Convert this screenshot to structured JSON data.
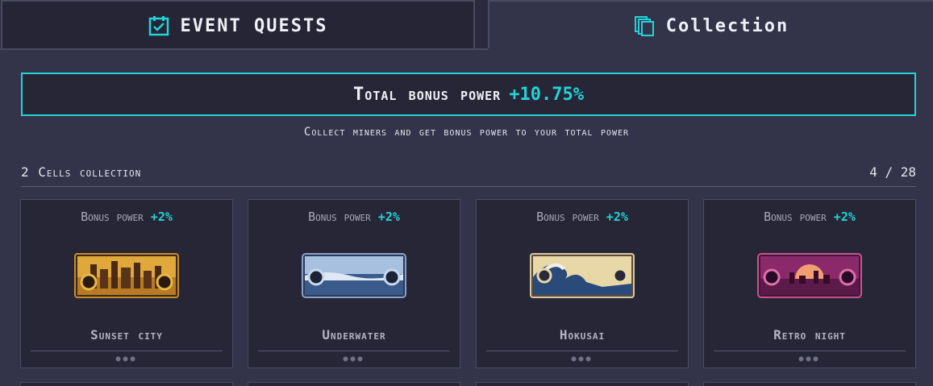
{
  "tabs": {
    "quests": {
      "label": "EVENT QUESTS",
      "icon": "calendar-check-icon"
    },
    "collection": {
      "label": "Collection",
      "icon": "cards-icon",
      "active": true
    }
  },
  "bonus": {
    "label": "Total bonus power",
    "value": "+10.75%"
  },
  "subtitle": "Collect miners and get bonus power to your total power",
  "section": {
    "title": "2 Cells collection",
    "count": "4 / 28"
  },
  "cards": [
    {
      "bonus_label": "Bonus power",
      "bonus_value": "+2%",
      "name": "Sunset city",
      "art": "sunset-city-miner-icon"
    },
    {
      "bonus_label": "Bonus power",
      "bonus_value": "+2%",
      "name": "Underwater",
      "art": "underwater-miner-icon"
    },
    {
      "bonus_label": "Bonus power",
      "bonus_value": "+2%",
      "name": "Hokusai",
      "art": "hokusai-miner-icon"
    },
    {
      "bonus_label": "Bonus power",
      "bonus_value": "+2%",
      "name": "Retro night",
      "art": "retro-night-miner-icon"
    }
  ],
  "colors": {
    "accent": "#23d3d8",
    "panel": "#33334a",
    "card": "#262636"
  }
}
